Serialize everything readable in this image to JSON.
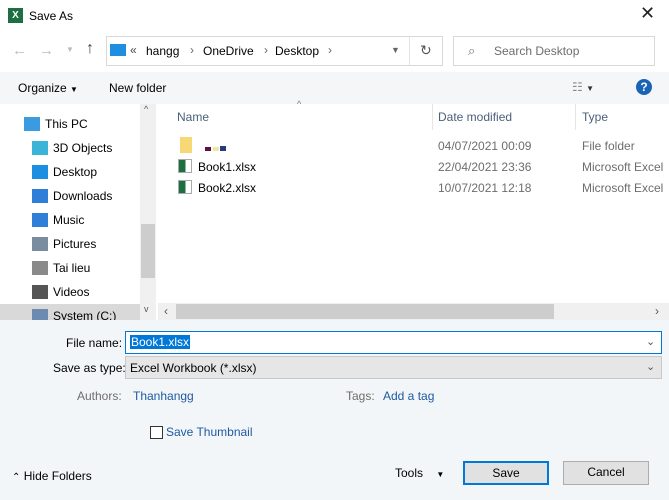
{
  "window": {
    "title": "Save As",
    "close_icon": "close-icon",
    "app_icon": "excel-icon"
  },
  "address": {
    "crumbs": [
      "hangg",
      "OneDrive",
      "Desktop"
    ],
    "overflow": "«",
    "search_placeholder": "Search Desktop"
  },
  "toolbar": {
    "organize": "Organize",
    "new_folder": "New folder",
    "help": "?"
  },
  "sidebar": {
    "items": [
      {
        "label": "This PC",
        "icon": "computer-icon",
        "color": "#3a9be0"
      },
      {
        "label": "3D Objects",
        "icon": "cube-icon",
        "color": "#3cb4d8"
      },
      {
        "label": "Desktop",
        "icon": "desktop-icon",
        "color": "#1e8fe0"
      },
      {
        "label": "Downloads",
        "icon": "download-arrow-icon",
        "color": "#2f7fd8"
      },
      {
        "label": "Music",
        "icon": "music-note-icon",
        "color": "#2f7fd8"
      },
      {
        "label": "Pictures",
        "icon": "pictures-icon",
        "color": "#7a8ca0"
      },
      {
        "label": "Tai lieu",
        "icon": "document-icon",
        "color": "#8a8a8a"
      },
      {
        "label": "Videos",
        "icon": "film-icon",
        "color": "#555555"
      },
      {
        "label": "System (C:)",
        "icon": "drive-icon",
        "color": "#6b8bb0"
      }
    ]
  },
  "columns": {
    "name": "Name",
    "date": "Date modified",
    "type": "Type"
  },
  "files": [
    {
      "name": "",
      "date": "04/07/2021 00:09",
      "type": "File folder",
      "icon": "folder-icon"
    },
    {
      "name": "Book1.xlsx",
      "date": "22/04/2021 23:36",
      "type": "Microsoft Excel",
      "icon": "excel-file-icon"
    },
    {
      "name": "Book2.xlsx",
      "date": "10/07/2021 12:18",
      "type": "Microsoft Excel",
      "icon": "excel-file-icon"
    }
  ],
  "form": {
    "file_name_label": "File name:",
    "file_name_value": "Book1.xlsx",
    "save_type_label": "Save as type:",
    "save_type_value": "Excel Workbook (*.xlsx)",
    "authors_label": "Authors:",
    "authors_value": "Thanhangg",
    "tags_label": "Tags:",
    "tags_value": "Add a tag",
    "thumbnail_label": "Save Thumbnail",
    "thumbnail_checked": false
  },
  "footer": {
    "hide_folders": "Hide Folders",
    "tools": "Tools",
    "save": "Save",
    "cancel": "Cancel"
  },
  "colors": {
    "accent": "#0078d7",
    "link": "#1e5aa0",
    "excel": "#1d6f42"
  }
}
